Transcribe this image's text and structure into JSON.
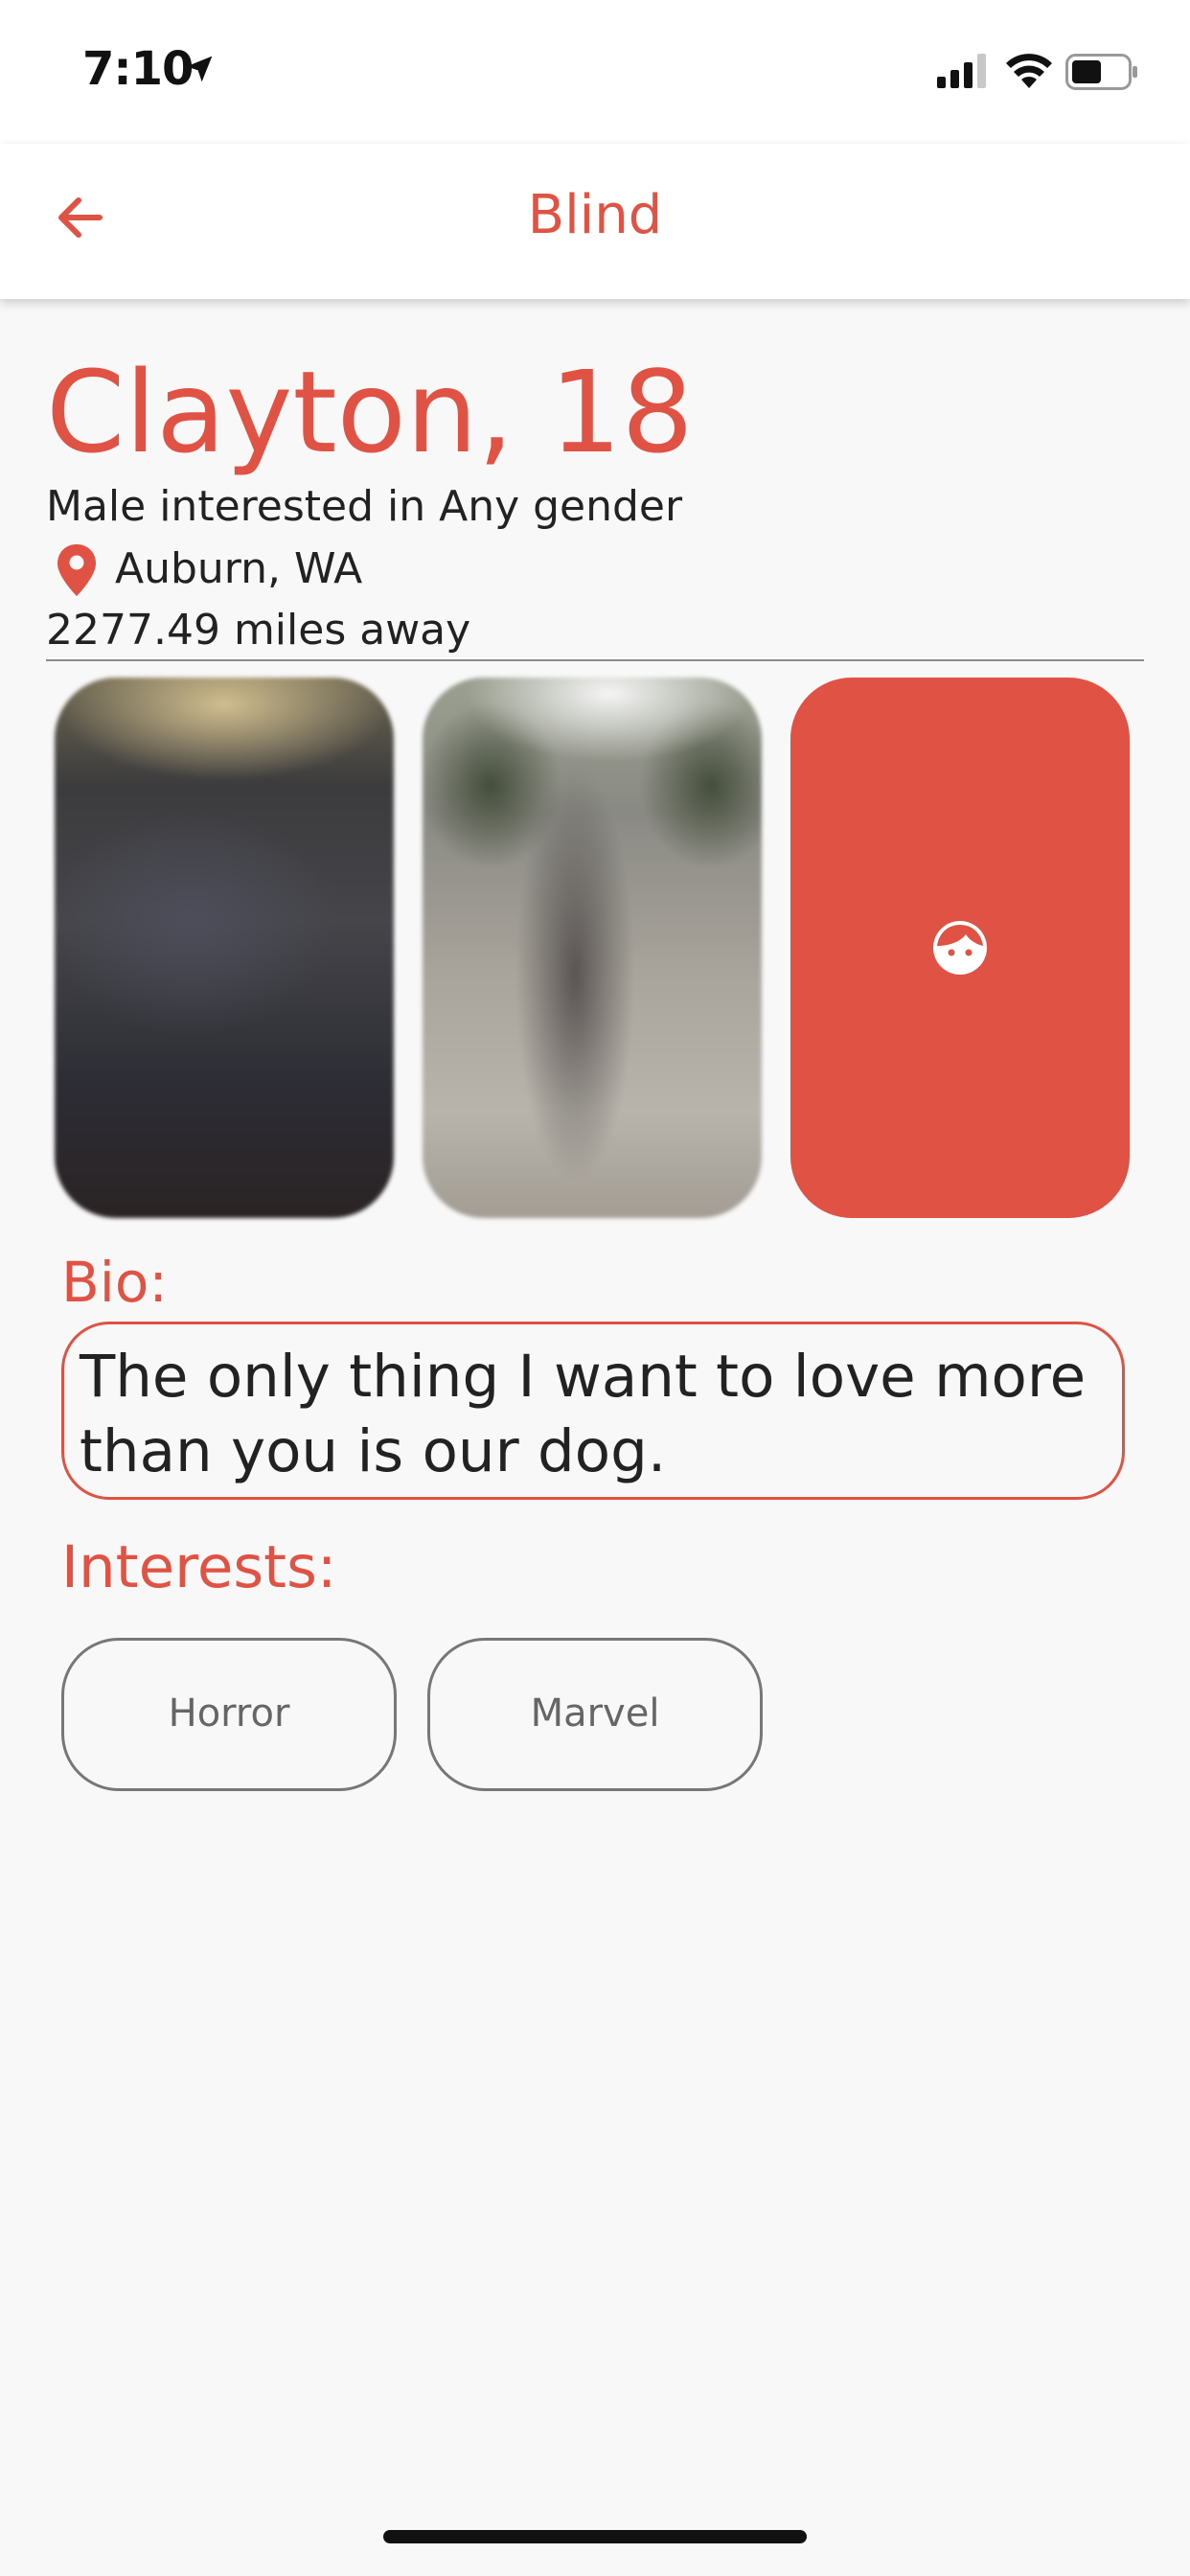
{
  "status_bar": {
    "time": "7:10"
  },
  "nav": {
    "title": "Blind"
  },
  "profile": {
    "name_age": "Clayton, 18",
    "orientation": "Male interested in Any gender",
    "location": "Auburn, WA",
    "distance": "2277.49 miles away"
  },
  "bio": {
    "label": "Bio:",
    "text": "The only thing I want to love more than you is our dog."
  },
  "interests": {
    "label": "Interests:",
    "items": [
      "Horror",
      "Marvel"
    ]
  },
  "colors": {
    "accent": "#e05243",
    "background": "#f8f8f8",
    "text": "#222222"
  },
  "icons": {
    "back": "arrow-left-icon",
    "location": "map-pin-icon",
    "photo_add": "face-icon"
  }
}
